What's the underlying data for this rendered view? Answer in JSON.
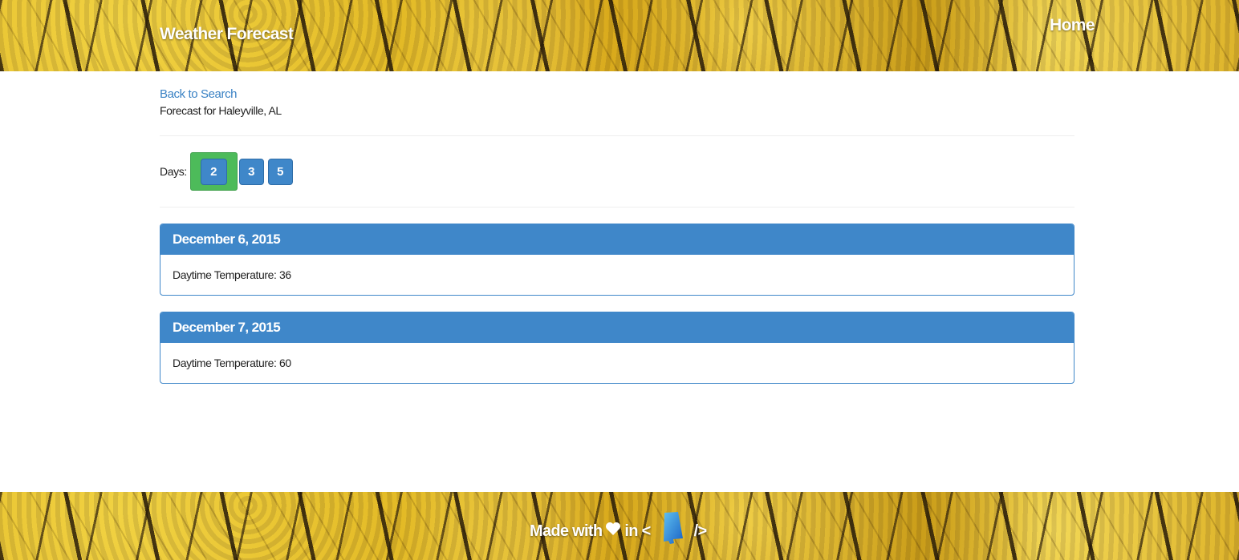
{
  "header": {
    "brand": "Weather Forecast",
    "nav_home": "Home"
  },
  "main": {
    "back_link": "Back to Search",
    "forecast_for": "Forecast for Haleyville, AL",
    "days_label": "Days:",
    "day_options": [
      "2",
      "3",
      "5"
    ],
    "selected_day": "2",
    "forecasts": [
      {
        "date": "December 6, 2015",
        "detail": "Daytime Temperature: 36"
      },
      {
        "date": "December 7, 2015",
        "detail": "Daytime Temperature: 60"
      }
    ]
  },
  "footer": {
    "made_with": "Made with",
    "in_text": "in <",
    "close_tag": "/>",
    "heart_icon": "heart-icon",
    "state_icon": "alabama-state-icon"
  },
  "colors": {
    "primary": "#3f87c9",
    "active_highlight": "#4dbb5a",
    "link": "#3a82c4"
  }
}
